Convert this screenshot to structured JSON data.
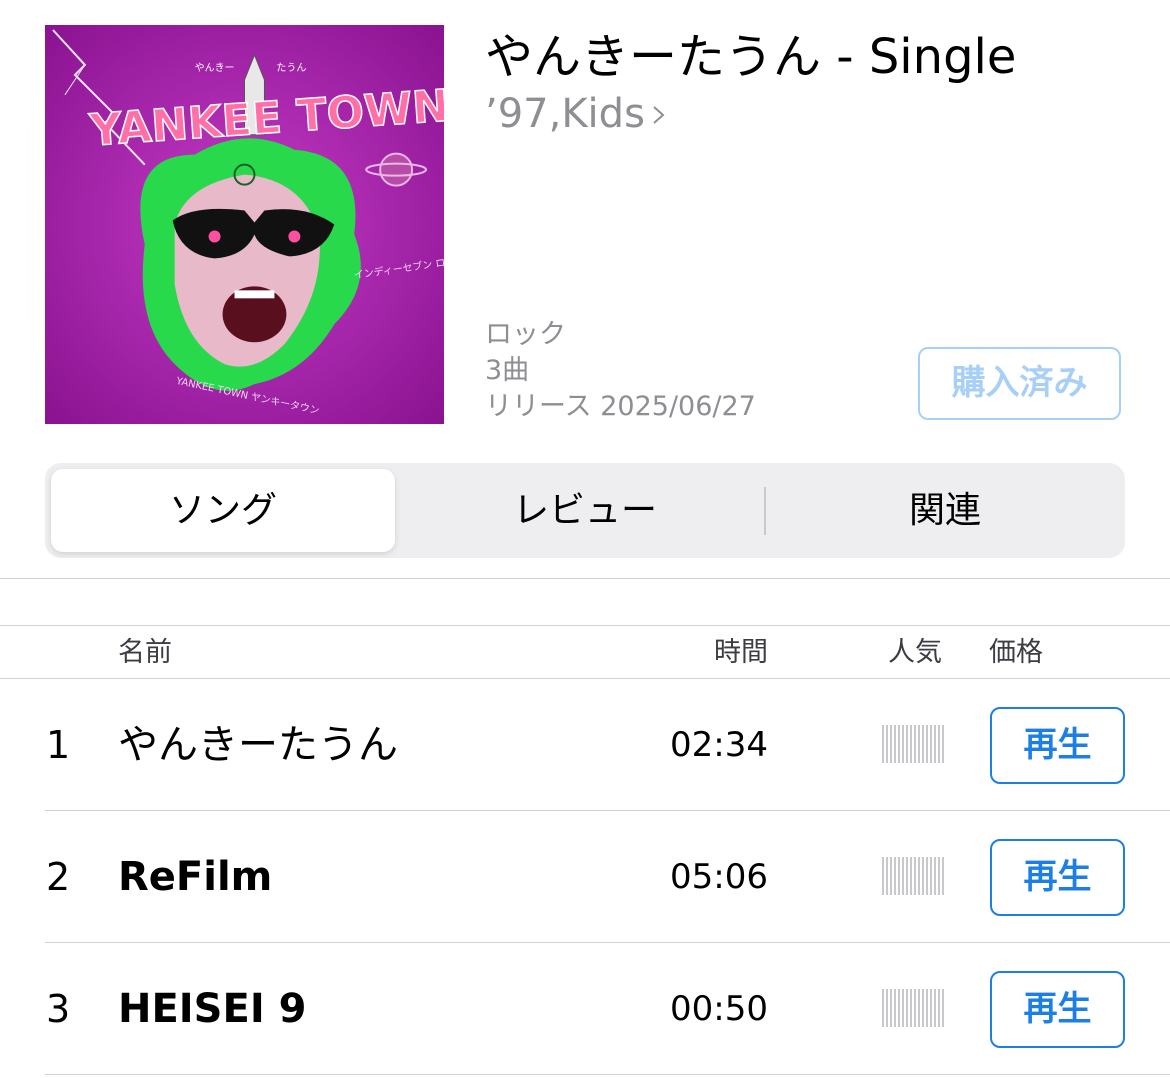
{
  "album": {
    "title": "やんきーたうん - Single",
    "artist": "’97,Kids",
    "genre": "ロック",
    "track_count": "3曲",
    "release": "リリース 2025/06/27",
    "buy_label": "購入済み",
    "artwork": {
      "text_top_left": "やんきー",
      "text_top_right": "たうん",
      "logo": "YANKEE TOWN",
      "bottom_text": "YANKEE TOWN ヤンキータウン",
      "side_text": "インディーセブン ロッポー",
      "background_color": "#a019a8",
      "hair_color": "#27d94b"
    }
  },
  "tabs": [
    {
      "label": "ソング",
      "active": true
    },
    {
      "label": "レビュー",
      "active": false
    },
    {
      "label": "関連",
      "active": false
    }
  ],
  "table": {
    "headers": {
      "name": "名前",
      "time": "時間",
      "popularity": "人気",
      "price": "価格"
    },
    "rows": [
      {
        "num": "1",
        "name": "やんきーたうん",
        "time": "02:34",
        "action": "再生"
      },
      {
        "num": "2",
        "name": "ReFilm",
        "time": "05:06",
        "action": "再生"
      },
      {
        "num": "3",
        "name": "HEISEI 9",
        "time": "00:50",
        "action": "再生"
      }
    ]
  },
  "colors": {
    "accent": "#1c7fe6",
    "accent_disabled": "#a8cff6",
    "secondary_text": "#8e8e93",
    "popularity_bar": "#c7c7cc"
  }
}
